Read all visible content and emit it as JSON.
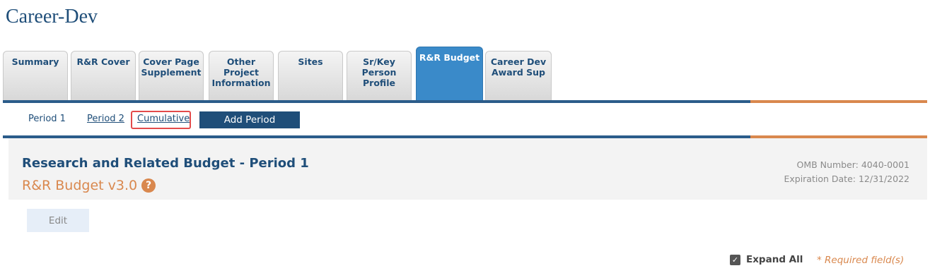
{
  "app_title": "Career-Dev",
  "tabs": [
    {
      "label": "Summary",
      "active": false
    },
    {
      "label": "R&R Cover",
      "active": false
    },
    {
      "label": "Cover Page\nSupplement",
      "active": false
    },
    {
      "label": "Other\nProject\nInformation",
      "active": false
    },
    {
      "label": "Sites",
      "active": false
    },
    {
      "label": "Sr/Key\nPerson\nProfile",
      "active": false
    },
    {
      "label": "R&R Budget",
      "active": true
    },
    {
      "label": "Career Dev\nAward Sup",
      "active": false
    }
  ],
  "periods": {
    "period1": "Period 1",
    "period2": "Period 2",
    "cumulative": "Cumulative",
    "add_period": "Add Period"
  },
  "form": {
    "title": "Research and Related Budget - Period 1",
    "version": "R&R Budget v3.0",
    "help_icon": "?",
    "omb_number": "OMB Number: 4040-0001",
    "expiration_date": "Expiration Date: 12/31/2022",
    "edit_label": "Edit",
    "expand_all_label": "Expand All",
    "expand_all_checked": true,
    "required_note": "* Required field(s)"
  },
  "colors": {
    "primary": "#1f4e79",
    "active_tab": "#3a8ac9",
    "accent_orange": "#d9884e",
    "highlight_red": "#e34b4b"
  }
}
